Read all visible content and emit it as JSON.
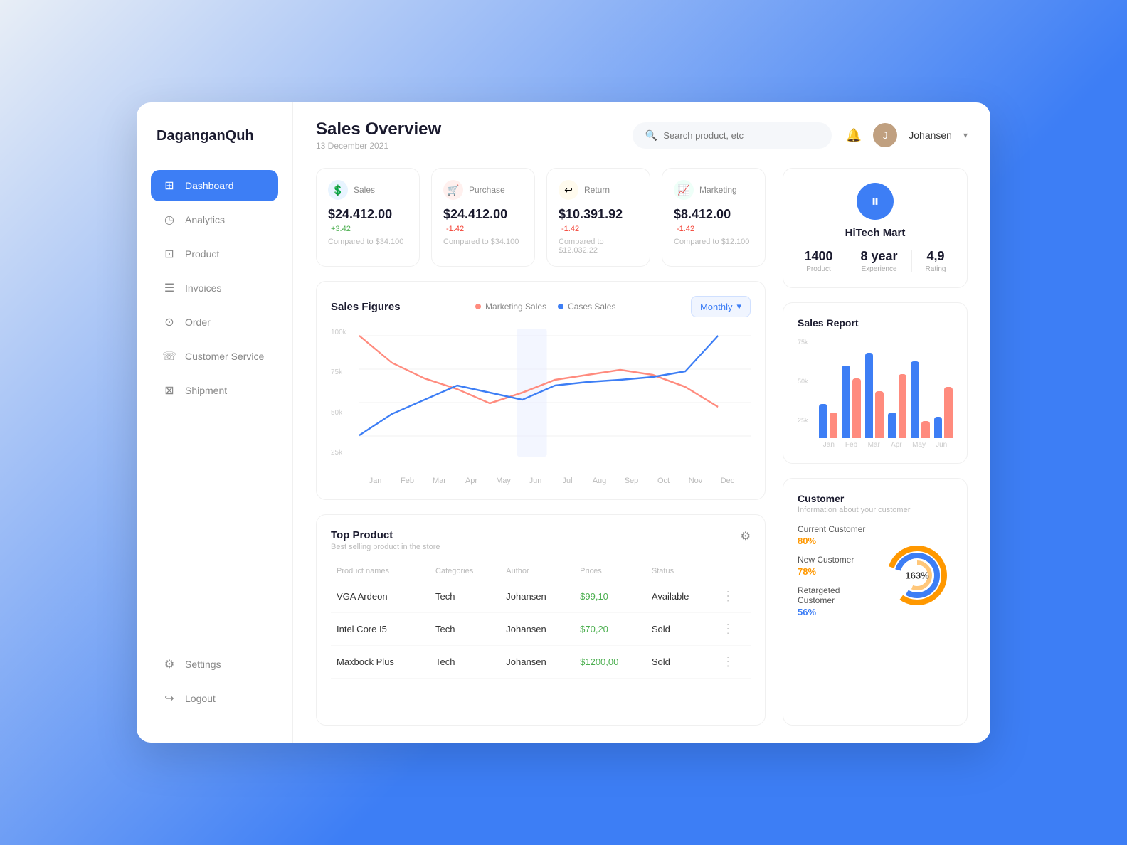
{
  "brand": "DaganganQuh",
  "header": {
    "title": "Sales Overview",
    "date": "13 December 2021",
    "search_placeholder": "Search product, etc",
    "user_name": "Johansen"
  },
  "nav": {
    "items": [
      {
        "id": "dashboard",
        "label": "Dashboard",
        "icon": "⊞",
        "active": true
      },
      {
        "id": "analytics",
        "label": "Analytics",
        "icon": "◷"
      },
      {
        "id": "product",
        "label": "Product",
        "icon": "⊡"
      },
      {
        "id": "invoices",
        "label": "Invoices",
        "icon": "☰"
      },
      {
        "id": "order",
        "label": "Order",
        "icon": "⊙"
      },
      {
        "id": "customer-service",
        "label": "Customer Service",
        "icon": "☏"
      },
      {
        "id": "shipment",
        "label": "Shipment",
        "icon": "⊠"
      }
    ],
    "bottom": [
      {
        "id": "settings",
        "label": "Settings",
        "icon": "⚙"
      },
      {
        "id": "logout",
        "label": "Logout",
        "icon": "↪"
      }
    ]
  },
  "stats": [
    {
      "label": "Sales",
      "value": "$24.412.00",
      "change": "+3.42",
      "change_type": "positive",
      "compare": "Compared to $34.100",
      "icon": "💲",
      "icon_bg": "#e8f4ff"
    },
    {
      "label": "Purchase",
      "value": "$24.412.00",
      "change": "-1.42",
      "change_type": "negative",
      "compare": "Compared to $34.100",
      "icon": "🛒",
      "icon_bg": "#fff0ee"
    },
    {
      "label": "Return",
      "value": "$10.391.92",
      "change": "-1.42",
      "change_type": "negative",
      "compare": "Compared to $12.032.22",
      "icon": "↩",
      "icon_bg": "#fffbee"
    },
    {
      "label": "Marketing",
      "value": "$8.412.00",
      "change": "-1.42",
      "change_type": "negative",
      "compare": "Compared to $12.100",
      "icon": "📈",
      "icon_bg": "#eefff8"
    }
  ],
  "chart": {
    "title": "Sales Figures",
    "period": "Monthly",
    "legend": [
      {
        "label": "Marketing Sales",
        "color": "#ff8b7e"
      },
      {
        "label": "Cases Sales",
        "color": "#3d7ef5"
      }
    ],
    "x_labels": [
      "Jan",
      "Feb",
      "Mar",
      "Apr",
      "May",
      "Jun",
      "Jul",
      "Aug",
      "Sep",
      "Oct",
      "Nov",
      "Dec"
    ],
    "marketing_data": [
      95,
      72,
      58,
      50,
      40,
      52,
      62,
      68,
      72,
      68,
      55,
      38
    ],
    "cases_data": [
      30,
      45,
      55,
      65,
      60,
      55,
      65,
      68,
      70,
      72,
      75,
      100
    ],
    "y_labels": [
      "100k",
      "75k",
      "50k",
      "25k"
    ]
  },
  "top_product": {
    "title": "Top Product",
    "subtitle": "Best selling product in the store",
    "columns": [
      "Product names",
      "Categories",
      "Author",
      "Prices",
      "Status",
      ""
    ],
    "rows": [
      {
        "name": "VGA Ardeon",
        "category": "Tech",
        "author": "Johansen",
        "price": "$99,10",
        "status": "Available"
      },
      {
        "name": "Intel Core I5",
        "category": "Tech",
        "author": "Johansen",
        "price": "$70,20",
        "status": "Sold"
      },
      {
        "name": "Maxbock Plus",
        "category": "Tech",
        "author": "Johansen",
        "price": "$1200,00",
        "status": "Sold"
      }
    ]
  },
  "store": {
    "name": "HiTech Mart",
    "icon": "⏸",
    "stats": [
      {
        "value": "1400",
        "label": "Product"
      },
      {
        "value": "8 year",
        "label": "Experience"
      },
      {
        "value": "4,9",
        "label": "Rating"
      }
    ]
  },
  "sales_report": {
    "title": "Sales Report",
    "y_labels": [
      "75k",
      "50k",
      "25k"
    ],
    "x_labels": [
      "Jan",
      "Feb",
      "Mar",
      "Apr",
      "May",
      "Jun"
    ],
    "bars": [
      {
        "blue": 40,
        "red": 30
      },
      {
        "blue": 85,
        "red": 70
      },
      {
        "blue": 100,
        "red": 55
      },
      {
        "blue": 30,
        "red": 75
      },
      {
        "blue": 90,
        "red": 20
      },
      {
        "blue": 25,
        "red": 60
      }
    ]
  },
  "customer": {
    "title": "Customer",
    "subtitle": "Information about your customer",
    "items": [
      {
        "label": "Current Customer",
        "pct": "80%",
        "pct_class": "pct-orange"
      },
      {
        "label": "New Customer",
        "pct": "78%",
        "pct_class": "pct-orange"
      },
      {
        "label": "Retargeted Customer",
        "pct": "56%",
        "pct_class": "pct-blue"
      }
    ],
    "donut_label": "163%",
    "donut_segments": [
      {
        "pct": 80,
        "color": "#ff9800"
      },
      {
        "pct": 78,
        "color": "#3d7ef5"
      },
      {
        "pct": 56,
        "color": "#ffd580"
      }
    ]
  }
}
